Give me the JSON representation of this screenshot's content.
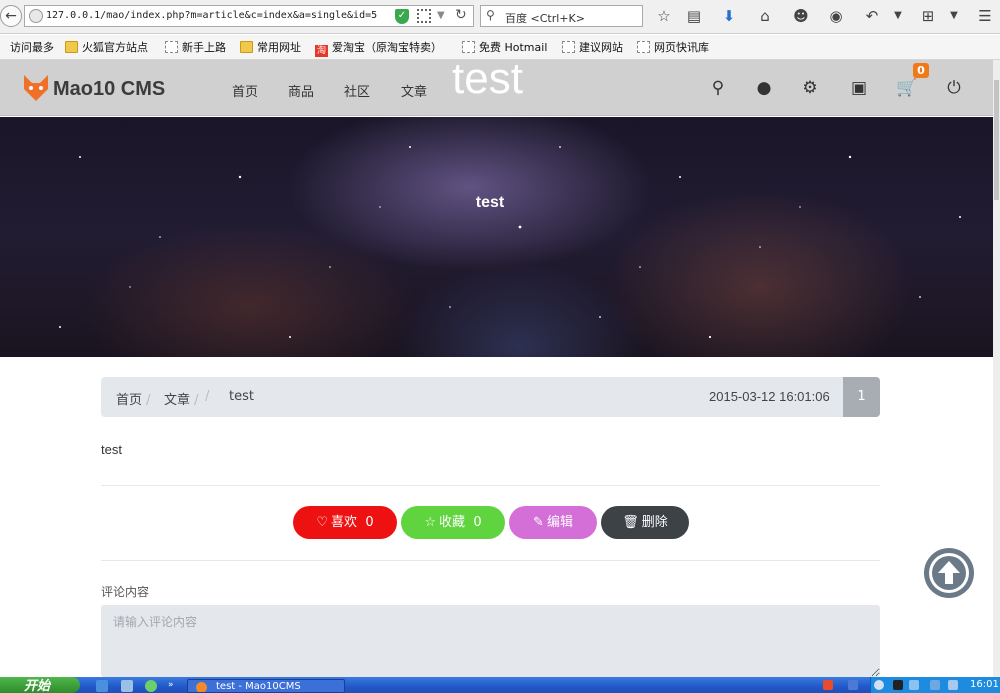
{
  "browser": {
    "url": "127.0.0.1/mao/index.php?m=article&c=index&a=single&id=5",
    "search_placeholder": "百度 <Ctrl+K>",
    "bookmarks": [
      {
        "label": "访问最多",
        "icon": "gear-bookmark-icon"
      },
      {
        "label": "火狐官方站点",
        "icon": "folder-icon"
      },
      {
        "label": "新手上路",
        "icon": "page-icon"
      },
      {
        "label": "常用网址",
        "icon": "folder-icon"
      },
      {
        "label": "爱淘宝（原淘宝特卖）",
        "icon": "taobao-icon"
      },
      {
        "label": "免费 Hotmail",
        "icon": "page-icon"
      },
      {
        "label": "建议网站",
        "icon": "page-icon"
      },
      {
        "label": "网页快讯库",
        "icon": "page-icon"
      }
    ]
  },
  "site": {
    "logo": "Mao10 CMS",
    "nav": [
      "首页",
      "商品",
      "社区",
      "文章"
    ],
    "overlay_title": "test",
    "cart_count": "0"
  },
  "banner": {
    "title": "test"
  },
  "breadcrumb": {
    "items": [
      "首页",
      "文章",
      "",
      "test"
    ],
    "date": "2015-03-12 16:01:06",
    "count": "1"
  },
  "article": {
    "body": "test"
  },
  "actions": {
    "like_label": "喜欢",
    "like_count": "0",
    "fav_label": "收藏",
    "fav_count": "0",
    "edit_label": "编辑",
    "delete_label": "删除",
    "colors": {
      "like": "#ee1111",
      "fav": "#5fd43e",
      "edit": "#d46fd8",
      "delete": "#3d4247"
    }
  },
  "comment": {
    "label": "评论内容",
    "placeholder": "请输入评论内容"
  },
  "taskbar": {
    "start_label": "开始",
    "task_label": "test - Mao10CMS",
    "clock": "16:01"
  }
}
